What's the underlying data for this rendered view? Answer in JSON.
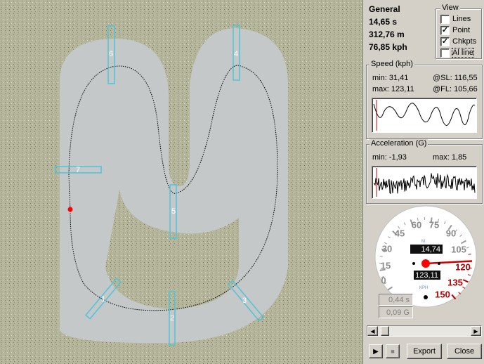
{
  "general": {
    "title": "General",
    "time": "14,65 s",
    "distance": "312,76 m",
    "speed": "76,85 kph"
  },
  "view": {
    "title": "View",
    "options": [
      {
        "label": "Lines",
        "checked": false
      },
      {
        "label": "Point",
        "checked": true
      },
      {
        "label": "Chkpts",
        "checked": true
      },
      {
        "label": "Al line",
        "checked": false
      }
    ]
  },
  "speed_panel": {
    "title": "Speed (kph)",
    "min": "min: 31,41",
    "max": "max: 123,11",
    "sl": "@SL: 116,55",
    "fl": "@FL: 105,66"
  },
  "accel_panel": {
    "title": "Acceleration (G)",
    "min": "min: -1,93",
    "max": "max: 1,85"
  },
  "gauge": {
    "scale_labels": [
      "0",
      "15",
      "30",
      "45",
      "60",
      "75",
      "90",
      "105",
      "120",
      "135",
      "150"
    ],
    "unit_m": "M",
    "unit_kph": "KPH",
    "lcd_top": "14,74",
    "lcd_bottom": "123,11",
    "needle_value": 120
  },
  "readouts": {
    "time": "0,44 s",
    "g": "0,09 G"
  },
  "playback": {
    "position": 0.03
  },
  "buttons": {
    "export": "Export",
    "close": "Close"
  },
  "checkpoints": [
    "1",
    "2",
    "3",
    "4",
    "5",
    "6",
    "7"
  ],
  "colors": {
    "checkpoint": "#4fc3d9",
    "marker": "#ff0000",
    "gauge_red": "#b00000"
  }
}
